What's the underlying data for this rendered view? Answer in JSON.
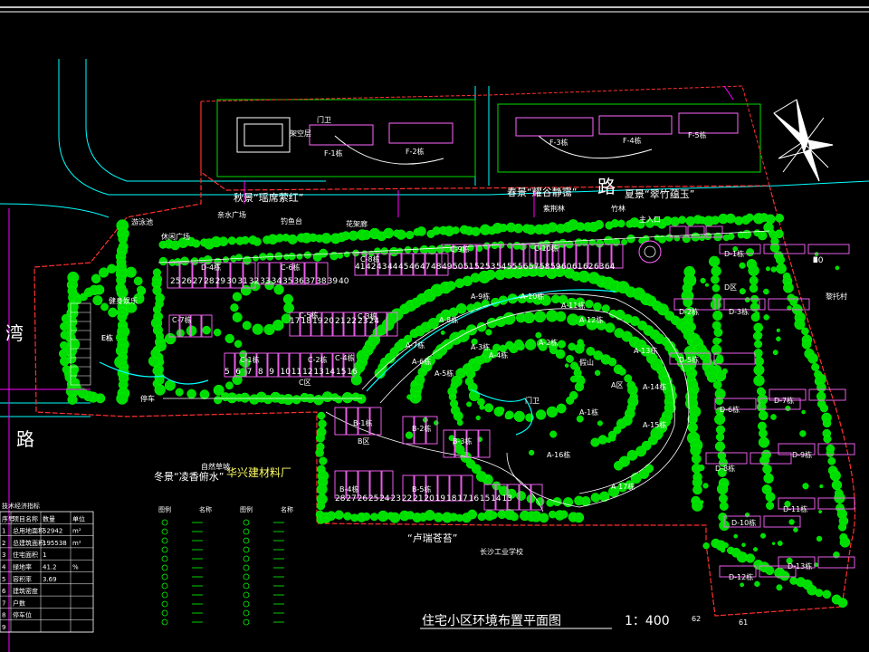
{
  "drawing": {
    "title": "住宅小区环境布置平面图",
    "scale": "1：400",
    "background": "#000000",
    "colors": {
      "road": "#00ffff",
      "site_boundary": "#ff3030",
      "magenta": "#ff00ff",
      "trees": "#00dd00",
      "text": "#ffffff",
      "yellow": "#ffff66"
    }
  },
  "roads": {
    "north_road": "路",
    "west_road_top": "湾",
    "west_road_bottom": "路"
  },
  "scenic_labels": {
    "autumn": "秋景“瑶席萦红”",
    "spring": "春景“耀谷静霭”",
    "summer": "夏景“翠竹蕴玉”",
    "winter": "冬景“凌香俯水”",
    "south": "“卢瑞苍苔”",
    "factory": "华兴建材料厂",
    "school": "长沙工业学校",
    "river_village": "黎托村",
    "main_entrance": "主入口"
  },
  "small_labels": [
    "游泳池",
    "休闲广场",
    "健身娱乐",
    "亲水广场",
    "钓鱼台",
    "花架廊",
    "自然草坡",
    "紫荆林",
    "竹林",
    "假山",
    "门卫",
    "停车",
    "A区",
    "B区",
    "C区",
    "D区",
    "E栋",
    "门卫",
    "架空层"
  ],
  "north_buildings": [
    "F-1栋",
    "F-2栋",
    "F-3栋",
    "F-4栋",
    "F-5栋"
  ],
  "buildings": [
    "D-4栋",
    "C-8栋",
    "C-9栋",
    "C-10栋",
    "C-6栋",
    "C-5栋",
    "C-7栋",
    "C-1栋",
    "C-2栋",
    "C-3栋",
    "C-4栋",
    "B-1栋",
    "B-2栋",
    "B-3栋",
    "B-4栋",
    "B-5栋",
    "A-1栋",
    "A-2栋",
    "A-3栋",
    "A-4栋",
    "A-5栋",
    "A-6栋",
    "A-7栋",
    "A-8栋",
    "A-9栋",
    "A-10栋",
    "A-11栋",
    "A-12栋",
    "A-13栋",
    "A-14栋",
    "A-15栋",
    "A-16栋",
    "A-17栋",
    "D-1栋",
    "D-2栋",
    "D-3栋",
    "D-5栋",
    "D-6栋",
    "D-7栋",
    "D-8栋",
    "D-9栋",
    "D-10栋",
    "D-11栋",
    "D-12栋",
    "D-13栋",
    "E栋"
  ],
  "unit_number_rows": {
    "row_top": [
      "25",
      "26",
      "27",
      "28",
      "29",
      "30",
      "31",
      "32",
      "33",
      "34",
      "35",
      "36",
      "37",
      "38",
      "39",
      "40"
    ],
    "row_top2": [
      "41",
      "42",
      "43",
      "44",
      "45",
      "46",
      "47",
      "48",
      "49",
      "50",
      "51",
      "52",
      "53",
      "54",
      "55",
      "56",
      "57",
      "58",
      "59",
      "60",
      "61",
      "62",
      "63",
      "64"
    ],
    "row_mid": [
      "17",
      "18",
      "19",
      "20",
      "21",
      "22",
      "23",
      "24"
    ],
    "row_c": [
      "5",
      "6",
      "7",
      "8",
      "9",
      "10",
      "11",
      "12",
      "13",
      "14",
      "15",
      "16"
    ],
    "row_south": [
      "28",
      "27",
      "26",
      "25",
      "24",
      "23",
      "22",
      "21",
      "20",
      "19",
      "18",
      "17",
      "16",
      "15",
      "14",
      "13"
    ],
    "row_d_right": [
      "1",
      "2",
      "3",
      "4",
      "5",
      "6",
      "7",
      "8",
      "9",
      "10",
      "11",
      "12",
      "13",
      "14",
      "15",
      "16"
    ]
  },
  "economic_table": {
    "title": "技术经济指标",
    "headers": [
      "序号",
      "项目名称",
      "数量",
      "单位"
    ],
    "rows": [
      [
        "1",
        "总用地面积",
        "52942",
        "m²"
      ],
      [
        "2",
        "总建筑面积",
        "195538",
        "m²"
      ],
      [
        "3",
        "住宅面积",
        "1",
        ""
      ],
      [
        "4",
        "绿地率",
        "41.2",
        "%"
      ],
      [
        "5",
        "容积率",
        "3.69",
        ""
      ],
      [
        "6",
        "建筑密度",
        "",
        ""
      ],
      [
        "7",
        "户数",
        "",
        ""
      ],
      [
        "8",
        "停车位",
        "",
        ""
      ],
      [
        "9",
        "",
        "",
        ""
      ]
    ]
  },
  "legend": {
    "columns": [
      "图例",
      "名称",
      "图例",
      "名称"
    ],
    "rows": 12
  },
  "corner_numbers": [
    "62",
    "61"
  ]
}
